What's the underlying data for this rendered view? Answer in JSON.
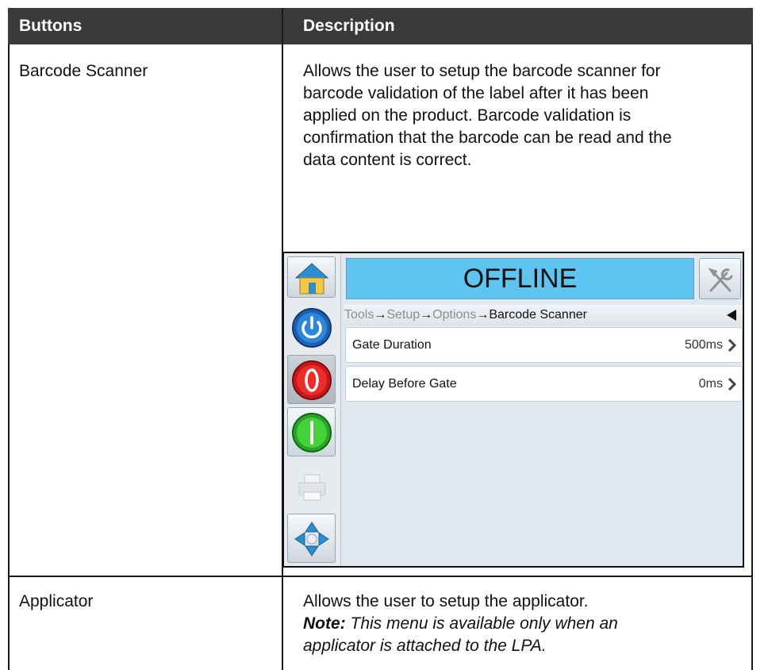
{
  "table": {
    "headers": [
      "Buttons",
      "Description"
    ],
    "rows": [
      {
        "button": "Barcode Scanner",
        "description": [
          "Allows the user to setup the barcode scanner for",
          "barcode validation of the label after it has been",
          "applied on the product. Barcode validation is",
          "confirmation that the barcode can be read and the",
          "data content is correct."
        ]
      },
      {
        "button": "Applicator",
        "description": [
          "Allows the user to setup the applicator."
        ],
        "note_label": "Note:",
        "note_lines": [
          " This menu is available only when an",
          "applicator is attached to the LPA."
        ]
      }
    ]
  },
  "screenshot": {
    "status": "OFFLINE",
    "status_color": "#5ec4f0",
    "breadcrumb": {
      "items": [
        "Tools",
        "Setup",
        "Options",
        "Barcode Scanner"
      ],
      "separator": "→"
    },
    "settings": [
      {
        "label": "Gate Duration",
        "value": "500ms"
      },
      {
        "label": "Delay Before Gate",
        "value": "0ms"
      }
    ],
    "sidebar_icons": [
      "home-icon",
      "power-icon",
      "stop-icon",
      "start-icon",
      "printer-icon",
      "navigate-icon"
    ],
    "header_icons": [
      "tools-icon",
      "back-icon"
    ]
  }
}
